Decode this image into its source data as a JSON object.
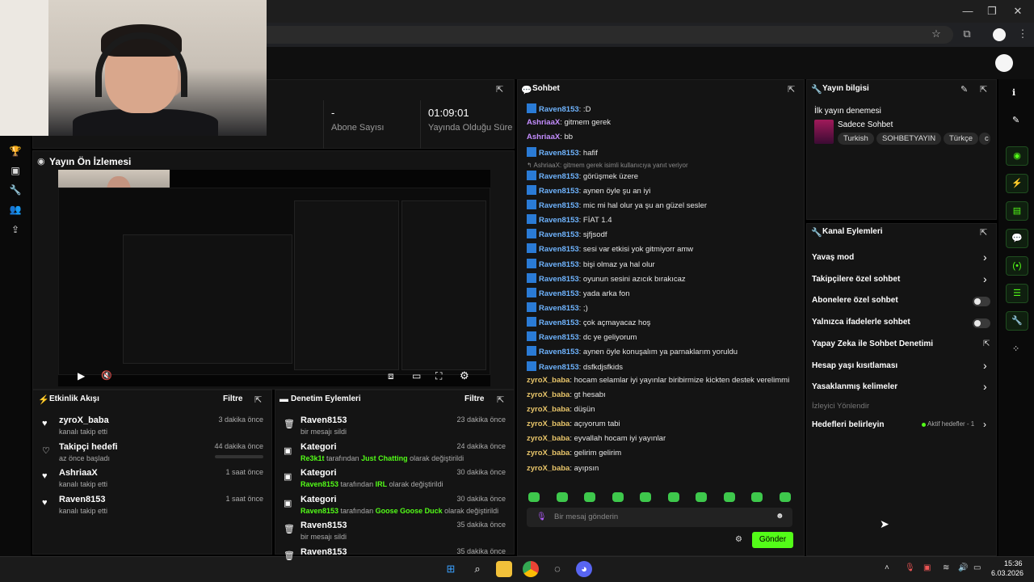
{
  "stats": {
    "subscribers_value": "-",
    "subscribers_label": "Abone Sayısı",
    "uptime_value": "01:09:01",
    "uptime_label": "Yayında Olduğu Süre"
  },
  "preview": {
    "title": "Yayın Ön İzlemesi"
  },
  "activity": {
    "title": "Etkinlik Akışı",
    "filter": "Filtre",
    "items": [
      {
        "name": "zyroX_baba",
        "sub": "kanalı takip etti",
        "time": "3 dakika önce"
      },
      {
        "name": "Takipçi hedefi",
        "sub": "az önce başladı",
        "time": "44 dakika önce"
      },
      {
        "name": "AshriaaX",
        "sub": "kanalı takip etti",
        "time": "1 saat önce"
      },
      {
        "name": "Raven8153",
        "sub": "kanalı takip etti",
        "time": "1 saat önce"
      }
    ]
  },
  "moderation": {
    "title": "Denetim Eylemleri",
    "filter": "Filtre",
    "items": [
      {
        "name": "Raven8153",
        "sub": "bir mesajı sildi",
        "time": "23 dakika önce"
      },
      {
        "name": "Kategori",
        "actor": "Re3k1t",
        "mid": " tarafından ",
        "target": "Just Chatting",
        "end": " olarak değiştirildi",
        "time": "24 dakika önce"
      },
      {
        "name": "Kategori",
        "actor": "Raven8153",
        "mid": " tarafından ",
        "target": "IRL",
        "end": " olarak değiştirildi",
        "time": "30 dakika önce"
      },
      {
        "name": "Kategori",
        "actor": "Raven8153",
        "mid": " tarafından ",
        "target": "Goose Goose Duck",
        "end": " olarak değiştirildi",
        "time": "30 dakika önce"
      },
      {
        "name": "Raven8153",
        "sub": "bir mesajı sildi",
        "time": "35 dakika önce"
      },
      {
        "name": "Raven8153",
        "sub": "",
        "time": "35 dakika önce"
      }
    ]
  },
  "chat": {
    "title": "Sohbet",
    "reply_hint": "AshriaaX: gitmem gerek isimli kullanıcıya yanıt veriyor",
    "messages": [
      {
        "user": "Raven8153",
        "text": ":D",
        "color": "blue",
        "badge": true
      },
      {
        "user": "AshriaaX",
        "text": "gitmem gerek",
        "color": "purple",
        "badge": false
      },
      {
        "user": "AshriaaX",
        "text": "bb",
        "color": "purple",
        "badge": false
      },
      {
        "user": "Raven8153",
        "text": "hafif",
        "color": "blue",
        "badge": true
      },
      {
        "user": "Raven8153",
        "text": "görüşmek üzere",
        "color": "blue",
        "badge": true
      },
      {
        "user": "Raven8153",
        "text": "aynen öyle şu an iyi",
        "color": "blue",
        "badge": true
      },
      {
        "user": "Raven8153",
        "text": "mic mi hal olur ya şu an güzel sesler",
        "color": "blue",
        "badge": true
      },
      {
        "user": "Raven8153",
        "text": "FİAT 1.4",
        "color": "blue",
        "badge": true
      },
      {
        "user": "Raven8153",
        "text": "sjfjsodf",
        "color": "blue",
        "badge": true
      },
      {
        "user": "Raven8153",
        "text": "sesi var etkisi yok gitmiyorr amw",
        "color": "blue",
        "badge": true
      },
      {
        "user": "Raven8153",
        "text": "bişi olmaz ya hal olur",
        "color": "blue",
        "badge": true
      },
      {
        "user": "Raven8153",
        "text": "oyunun sesini azıcık bırakıcaz",
        "color": "blue",
        "badge": true
      },
      {
        "user": "Raven8153",
        "text": "yada arka fon",
        "color": "blue",
        "badge": true
      },
      {
        "user": "Raven8153",
        "text": ";)",
        "color": "blue",
        "badge": true
      },
      {
        "user": "Raven8153",
        "text": "çok açmayacaz hoş",
        "color": "blue",
        "badge": true
      },
      {
        "user": "Raven8153",
        "text": "dc ye geliyorum",
        "color": "blue",
        "badge": true
      },
      {
        "user": "Raven8153",
        "text": "aynen öyle konuşalım ya parnaklarım yoruldu",
        "color": "blue",
        "badge": true
      },
      {
        "user": "Raven8153",
        "text": "dsfkdjsfkids",
        "color": "blue",
        "badge": true
      },
      {
        "user": "zyroX_baba",
        "text": "hocam selamlar iyi yayınlar biribirmize kickten destek verelimmi",
        "color": "yellow",
        "badge": false
      },
      {
        "user": "zyroX_baba",
        "text": "gt hesabı",
        "color": "yellow",
        "badge": false
      },
      {
        "user": "zyroX_baba",
        "text": "düşün",
        "color": "yellow",
        "badge": false
      },
      {
        "user": "zyroX_baba",
        "text": "açıyorum tabi",
        "color": "yellow",
        "badge": false
      },
      {
        "user": "zyroX_baba",
        "text": "eyvallah hocam iyi yayınlar",
        "color": "yellow",
        "badge": false
      },
      {
        "user": "zyroX_baba",
        "text": "gelirim gelirim",
        "color": "yellow",
        "badge": false
      },
      {
        "user": "zyroX_baba",
        "text": "ayıpsın",
        "color": "yellow",
        "badge": false
      }
    ],
    "input_placeholder": "Bir mesaj gönderin",
    "send": "Gönder"
  },
  "stream_info": {
    "title": "Yayın bilgisi",
    "stream_title": "İlk yayın denemesi",
    "category": "Sadece Sohbet",
    "tags": [
      "Turkish",
      "SOHBETYAYIN",
      "Türkçe"
    ]
  },
  "channel_actions": {
    "title": "Kanal Eylemleri",
    "items": [
      {
        "label": "Yavaş mod",
        "type": "chevron"
      },
      {
        "label": "Takipçilere özel sohbet",
        "type": "chevron"
      },
      {
        "label": "Abonelere özel sohbet",
        "type": "toggle"
      },
      {
        "label": "Yalnızca ifadelerle sohbet",
        "type": "toggle"
      },
      {
        "label": "Yapay Zeka ile Sohbet Denetimi",
        "type": "external"
      },
      {
        "label": "Hesap yaşı kısıtlaması",
        "type": "chevron"
      },
      {
        "label": "Yasaklanmış kelimeler",
        "type": "chevron"
      }
    ],
    "viewer_redirect": "İzleyici Yönlendir",
    "goals_label": "Hedefleri belirleyin",
    "goals_status": "Aktif hedefler - 1"
  },
  "taskbar": {
    "time": "15:36",
    "date": "6.03.2026"
  },
  "colors": {
    "accent": "#53fc18",
    "panel": "#141414",
    "bg": "#000000"
  }
}
